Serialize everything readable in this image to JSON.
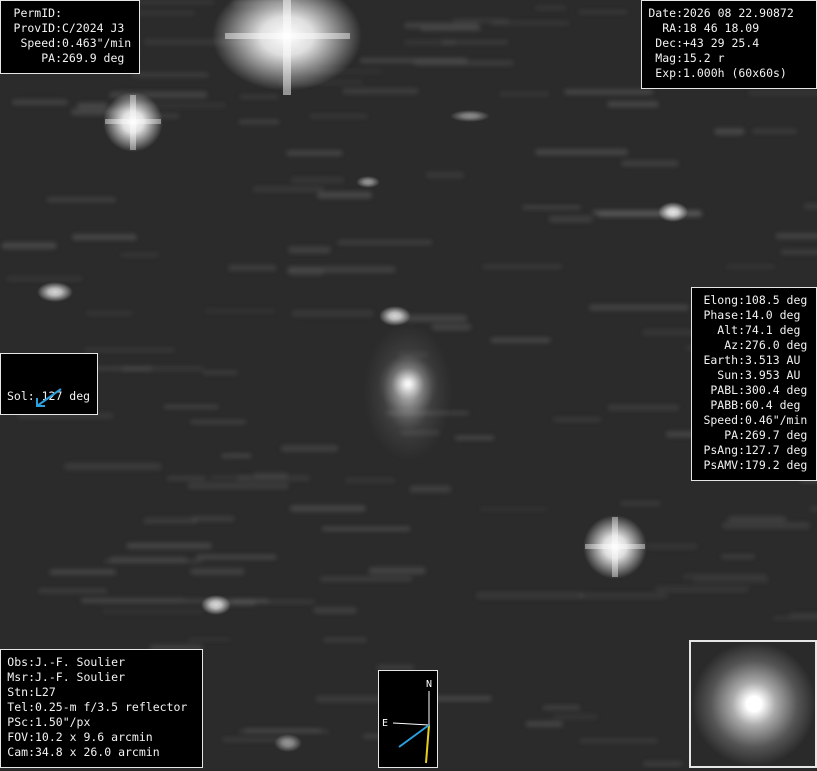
{
  "top_left": [
    {
      "label": "PermID:",
      "value": ""
    },
    {
      "label": "ProvID:",
      "value": "C/2024 J3"
    },
    {
      "label": "Speed:",
      "value": "0.463\"/min"
    },
    {
      "label": "PA:",
      "value": "269.9 deg"
    }
  ],
  "top_right": [
    {
      "label": "Date:",
      "value": "2026 08 22.90872"
    },
    {
      "label": "RA:",
      "value": "18 46 18.09"
    },
    {
      "label": "Dec:",
      "value": "+43 29 25.4"
    },
    {
      "label": "Mag:",
      "value": "15.2 r"
    },
    {
      "label": "Exp:",
      "value": "1.000h (60x60s)"
    }
  ],
  "mid_right": [
    {
      "label": "Elong:",
      "value": "108.5 deg"
    },
    {
      "label": "Phase:",
      "value": "14.0 deg"
    },
    {
      "label": "Alt:",
      "value": "74.1 deg"
    },
    {
      "label": "Az:",
      "value": "276.0 deg"
    },
    {
      "label": "Earth:",
      "value": "3.513 AU"
    },
    {
      "label": "Sun:",
      "value": "3.953 AU"
    },
    {
      "label": "PABL:",
      "value": "300.4 deg"
    },
    {
      "label": "PABB:",
      "value": "60.4 deg"
    },
    {
      "label": "Speed:",
      "value": "0.46\"/min"
    },
    {
      "label": "PA:",
      "value": "269.7 deg"
    },
    {
      "label": "PsAng:",
      "value": "127.7 deg"
    },
    {
      "label": "PsAMV:",
      "value": "179.2 deg"
    }
  ],
  "bottom_left": [
    {
      "label": "Obs:",
      "value": "J.-F. Soulier"
    },
    {
      "label": "Msr:",
      "value": "J.-F. Soulier"
    },
    {
      "label": "Stn:",
      "value": "L27"
    },
    {
      "label": "Tel:",
      "value": "0.25-m f/3.5 reflector"
    },
    {
      "label": "PSc:",
      "value": "1.50\"/px"
    },
    {
      "label": "FOV:",
      "value": "10.2 x 9.6 arcmin"
    },
    {
      "label": "Cam:",
      "value": "34.8 x 26.0 arcmin"
    }
  ],
  "sol": {
    "text": "Sol: 127 deg"
  },
  "compass": {
    "north": "N",
    "east": "E"
  },
  "colors": {
    "arrow": "#2aa0e0",
    "motion": "#e8d020",
    "text": "#f2f2f2"
  }
}
